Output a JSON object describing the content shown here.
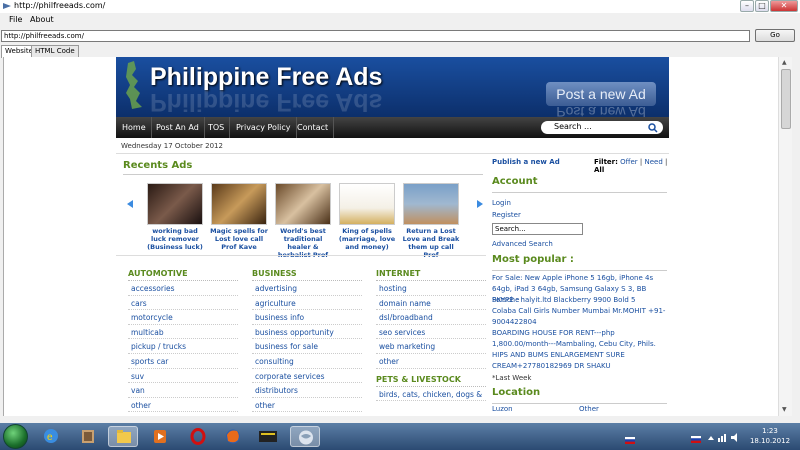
{
  "window": {
    "title": "http://philfreeads.com/",
    "controls": [
      "minimize",
      "maximize",
      "close"
    ]
  },
  "menu": {
    "items": [
      "File",
      "About"
    ]
  },
  "addressbar": {
    "url": "http://philfreeads.com/",
    "go_label": "Go"
  },
  "tabs": [
    {
      "label": "Website",
      "active": true
    },
    {
      "label": "HTML Code",
      "active": false
    }
  ],
  "site": {
    "name": "Philippine Free Ads",
    "post_ad_label": "Post a new Ad",
    "nav": [
      "Home",
      "Post An Ad",
      "TOS",
      "Privacy Policy",
      "Contact"
    ],
    "search_placeholder": "Search ...",
    "date": "Wednesday 17 October 2012",
    "recent_title": "Recents Ads",
    "recent_ads": [
      {
        "caption": "working bad luck remover (Business luck)"
      },
      {
        "caption": "Magic spells for Lost love call Prof Kave"
      },
      {
        "caption": "World's best traditional healer & herbalist Prof"
      },
      {
        "caption": "King of spells (marriage, love and money)"
      },
      {
        "caption": "Return a Lost Love and Break them up call Prof"
      }
    ],
    "categories": [
      {
        "head": "AUTOMOTIVE",
        "links": [
          "accessories",
          "cars",
          "motorcycle",
          "multicab",
          "pickup / trucks",
          "sports car",
          "suv",
          "van",
          "other"
        ]
      },
      {
        "head": "BUSINESS",
        "links": [
          "advertising",
          "agriculture",
          "business info",
          "business opportunity",
          "business for sale",
          "consulting",
          "corporate services",
          "distributors",
          "other"
        ]
      },
      {
        "head": "INTERNET",
        "links": [
          "hosting",
          "domain name",
          "dsl/broadband",
          "seo services",
          "web marketing",
          "other"
        ]
      },
      {
        "head": "PETS & LIVESTOCK",
        "links": [
          "birds, cats, chicken, dogs &"
        ]
      }
    ],
    "sidebar": {
      "publish_label": "Publish a new Ad",
      "filter_label": "Filter:",
      "filter_options": [
        "Offer",
        "Need",
        "All"
      ],
      "account_title": "Account",
      "login_label": "Login",
      "register_label": "Register",
      "search_value": "Search...",
      "advanced_search_label": "Advanced Search",
      "popular_title": "Most popular :",
      "popular_items": [
        "For Sale: New Apple iPhone 5 16gb, iPhone 4s 64gb, iPad 3 64gb, Samsung Galaxy S 3, BB Porsche",
        "SKYPE : halyit.ltd Blackberry 9900 Bold 5",
        "Colaba Call Girls Number Mumbai Mr.MOHIT +91-9004422804",
        "BOARDING HOUSE FOR RENT---php 1,800.00/month---Mambaling, Cebu City, Phils.",
        "HIPS AND BUMS ENLARGEMENT SURE CREAM+27780182969 DR SHAKU"
      ],
      "last_week": "*Last Week",
      "location_title": "Location",
      "locations": [
        "Luzon",
        "Other"
      ]
    }
  },
  "taskbar": {
    "clock_time": "1:23",
    "clock_date": "18.10.2012",
    "colors": {
      "bar": "#2b4a72",
      "accent": "#5a8a1e",
      "link": "#1a4fa0"
    }
  }
}
